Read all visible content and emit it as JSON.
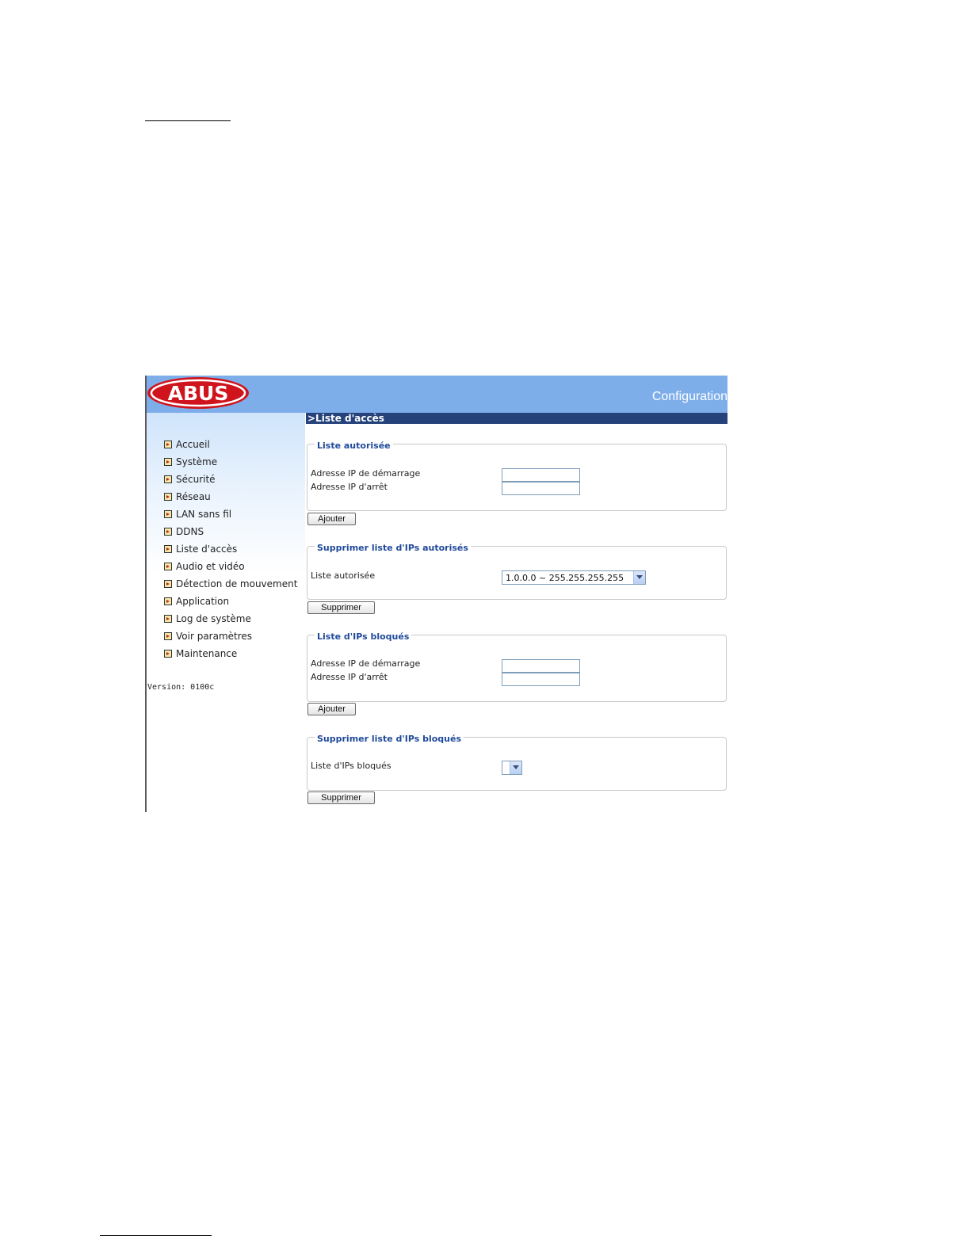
{
  "header": {
    "logo_text": "ABUS",
    "config_title": "Configuration"
  },
  "colors": {
    "header_bg": "#7eaeea",
    "title_bar_bg": "#25427b",
    "legend_text": "#1f4a9a",
    "logo_red": "#d0141e"
  },
  "sidebar": {
    "items": [
      {
        "label": "Accueil",
        "icon": "arrow-bullet-icon"
      },
      {
        "label": "Système",
        "icon": "arrow-bullet-icon"
      },
      {
        "label": "Sécurité",
        "icon": "arrow-bullet-icon"
      },
      {
        "label": "Réseau",
        "icon": "arrow-bullet-icon"
      },
      {
        "label": "LAN sans fil",
        "icon": "arrow-bullet-icon"
      },
      {
        "label": "DDNS",
        "icon": "arrow-bullet-icon"
      },
      {
        "label": "Liste d'accès",
        "icon": "arrow-bullet-icon"
      },
      {
        "label": "Audio et vidéo",
        "icon": "arrow-bullet-icon"
      },
      {
        "label": "Détection de mouvement",
        "icon": "arrow-bullet-icon"
      },
      {
        "label": "Application",
        "icon": "arrow-bullet-icon"
      },
      {
        "label": "Log de système",
        "icon": "arrow-bullet-icon"
      },
      {
        "label": "Voir paramètres",
        "icon": "arrow-bullet-icon"
      },
      {
        "label": "Maintenance",
        "icon": "arrow-bullet-icon"
      }
    ],
    "version": "Version: 0100c"
  },
  "main": {
    "title": ">Liste d'accès",
    "allowed": {
      "legend": "Liste autorisée",
      "start_label": "Adresse IP de démarrage",
      "end_label": "Adresse IP d'arrêt",
      "start_value": "",
      "end_value": "",
      "add_button": "Ajouter"
    },
    "delete_allowed": {
      "legend": "Supprimer liste d'IPs autorisés",
      "list_label": "Liste autorisée",
      "selected": "1.0.0.0 ~ 255.255.255.255",
      "delete_button": "Supprimer"
    },
    "blocked": {
      "legend": "Liste d'IPs bloqués",
      "start_label": "Adresse IP de démarrage",
      "end_label": "Adresse IP d'arrêt",
      "start_value": "",
      "end_value": "",
      "add_button": "Ajouter"
    },
    "delete_blocked": {
      "legend": "Supprimer liste d'IPs bloqués",
      "list_label": "Liste d'IPs bloqués",
      "selected": "",
      "delete_button": "Supprimer"
    }
  }
}
